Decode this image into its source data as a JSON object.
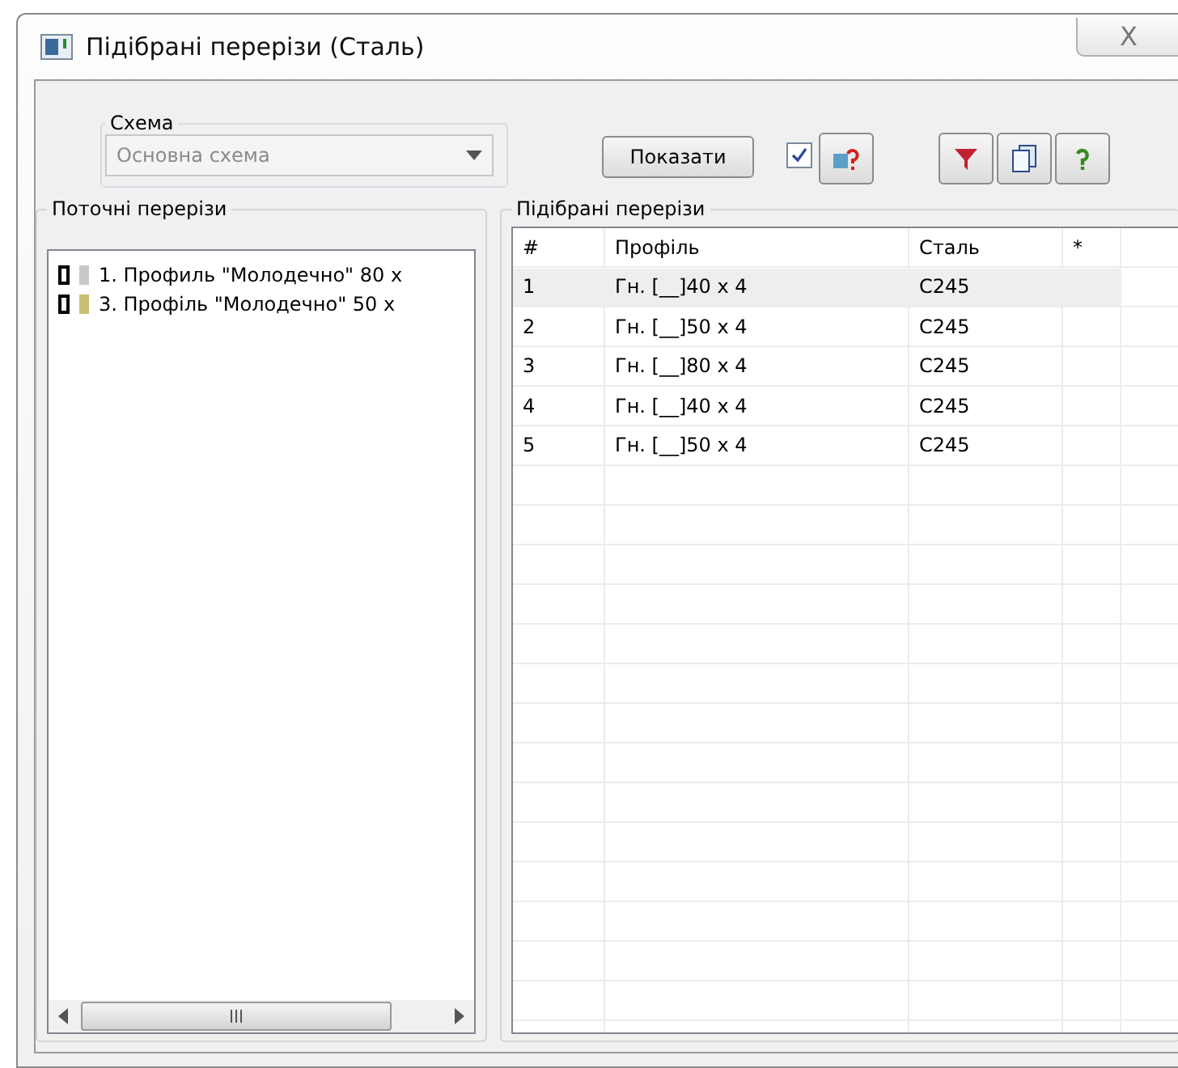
{
  "window": {
    "title": "Підібрані перерізи (Сталь)",
    "close": "X"
  },
  "schema": {
    "label": "Схема",
    "value": "Основна схема",
    "disabled": true
  },
  "toolbar": {
    "show_button": "Показати",
    "checkbox": {
      "checked": true
    }
  },
  "current_sections": {
    "title": "Поточні перерізи",
    "items": [
      {
        "label": "1. Профиль \"Молодечно\" 80 х",
        "color": "#c8c8c8"
      },
      {
        "label": "3. Профіль \"Молодечно\" 50 х",
        "color": "#c8c070"
      }
    ]
  },
  "selected_sections": {
    "title": "Підібрані перерізи",
    "columns": [
      "#",
      "Профіль",
      "Сталь",
      "*"
    ],
    "rows": [
      {
        "cells": [
          "1",
          "Гн. [__]40 x 4",
          "C245"
        ],
        "selected": true
      },
      {
        "cells": [
          "2",
          "Гн. [__]50 x 4",
          "C245"
        ],
        "selected": false
      },
      {
        "cells": [
          "3",
          "Гн. [__]80 x 4",
          "C245"
        ],
        "selected": false
      },
      {
        "cells": [
          "4",
          "Гн. [__]40 x 4",
          "C245"
        ],
        "selected": false
      },
      {
        "cells": [
          "5",
          "Гн. [__]50 x 4",
          "C245"
        ],
        "selected": false
      }
    ]
  }
}
